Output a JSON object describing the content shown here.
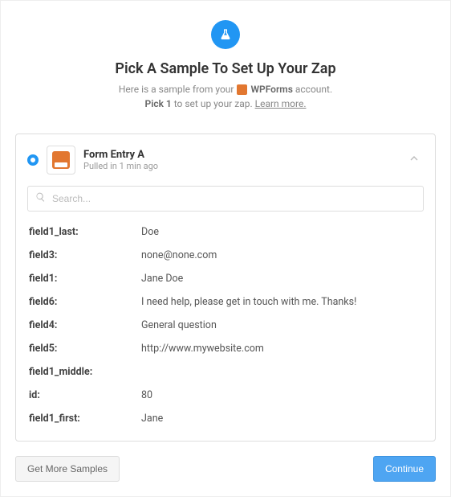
{
  "header": {
    "title": "Pick A Sample To Set Up Your Zap",
    "intro_prefix": "Here is a sample from your",
    "service_name": "WPForms",
    "intro_suffix": "account.",
    "pick_label": "Pick 1",
    "pick_suffix": "to set up your zap.",
    "learn_more": "Learn more."
  },
  "sample": {
    "name": "Form Entry A",
    "subtitle": "Pulled in 1 min ago"
  },
  "search": {
    "placeholder": "Search..."
  },
  "fields": [
    {
      "key": "field1_last:",
      "value": "Doe"
    },
    {
      "key": "field3:",
      "value": "none@none.com"
    },
    {
      "key": "field1:",
      "value": "Jane Doe"
    },
    {
      "key": "field6:",
      "value": "I need help, please get in touch with me. Thanks!"
    },
    {
      "key": "field4:",
      "value": "General question"
    },
    {
      "key": "field5:",
      "value": "http://www.mywebsite.com"
    },
    {
      "key": "field1_middle:",
      "value": ""
    },
    {
      "key": "id:",
      "value": "80"
    },
    {
      "key": "field1_first:",
      "value": "Jane"
    }
  ],
  "footer": {
    "get_more": "Get More Samples",
    "continue": "Continue"
  }
}
